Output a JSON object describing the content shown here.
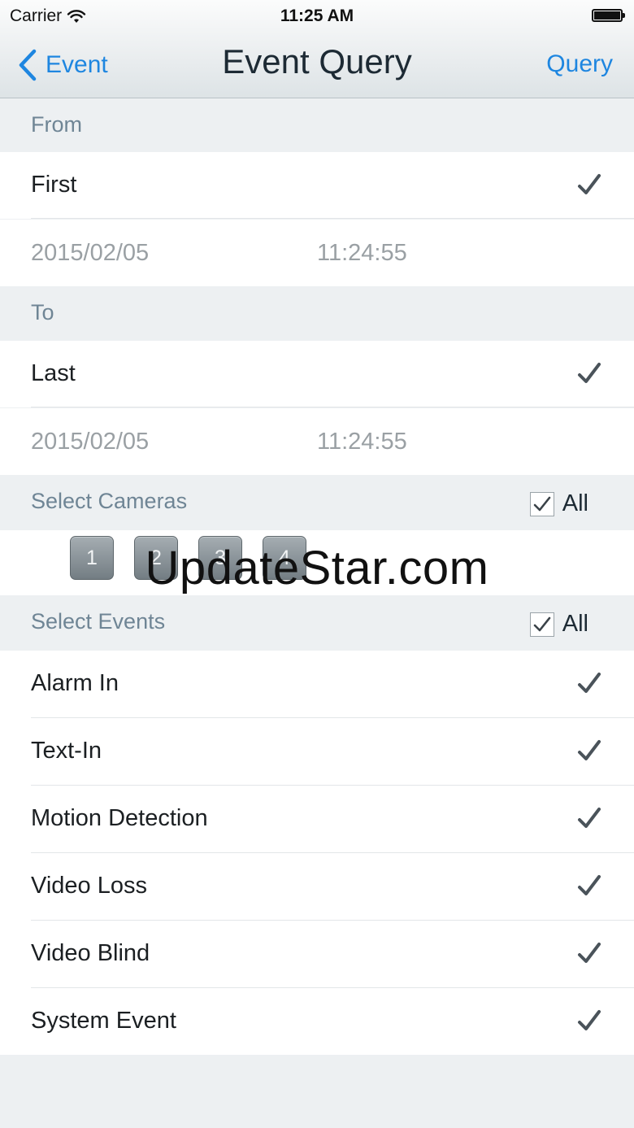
{
  "status_bar": {
    "carrier": "Carrier",
    "time": "11:25 AM"
  },
  "nav": {
    "back_label": "Event",
    "title": "Event Query",
    "action_label": "Query"
  },
  "from": {
    "header": "From",
    "option": "First",
    "date": "2015/02/05",
    "time": "11:24:55"
  },
  "to": {
    "header": "To",
    "option": "Last",
    "date": "2015/02/05",
    "time": "11:24:55"
  },
  "cameras": {
    "header": "Select Cameras",
    "all_label": "All",
    "buttons": [
      "1",
      "2",
      "3",
      "4"
    ]
  },
  "events": {
    "header": "Select Events",
    "all_label": "All",
    "items": [
      "Alarm In",
      "Text-In",
      "Motion Detection",
      "Video Loss",
      "Video Blind",
      "System Event"
    ]
  },
  "watermark": "UpdateStar.com",
  "colors": {
    "accent": "#1e86e0",
    "section_header_text": "#6f8595",
    "check": "#4a535a"
  }
}
